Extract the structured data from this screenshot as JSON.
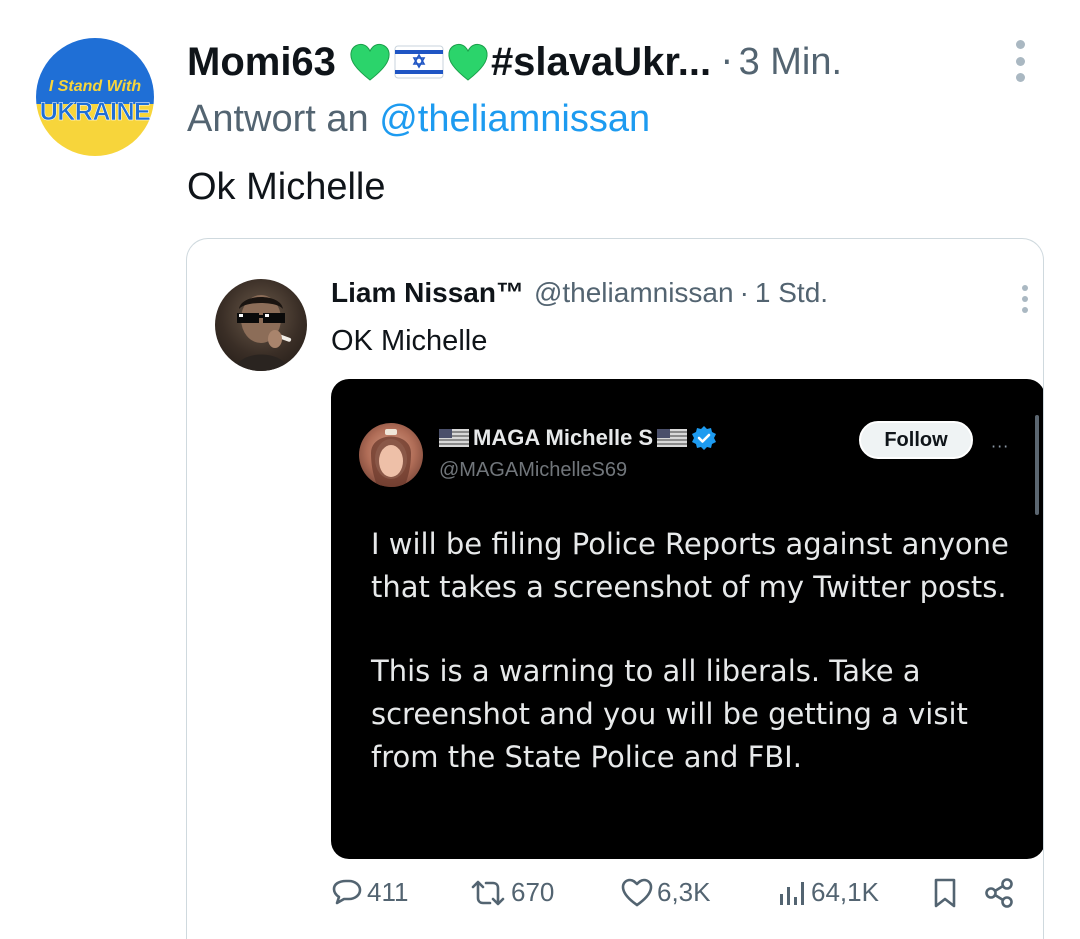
{
  "post": {
    "avatar": {
      "line1": "I Stand With",
      "line2": "UKRAINE"
    },
    "display_name_start": "Momi63",
    "display_name_end": "#slavaUkr...",
    "separator": "·",
    "time": "3 Min.",
    "reply_prefix": "Antwort an",
    "reply_handle": "@theliamnissan",
    "text": "Ok Michelle",
    "icons": [
      "green-heart-icon",
      "israel-flag-icon",
      "green-heart-icon",
      "more-vert-icon"
    ]
  },
  "quote": {
    "name": "Liam Nissan™",
    "handle": "@theliamnissan",
    "separator": "·",
    "time": "1 Std.",
    "text": "OK Michelle",
    "embedded": {
      "name": "MAGA Michelle S",
      "handle": "@MAGAMichelleS69",
      "follow_label": "Follow",
      "more_label": "···",
      "paragraph1": "I will be filing Police Reports against anyone that takes a screenshot of my Twitter posts.",
      "paragraph2": "This is a warning to all liberals. Take a screenshot and you will be getting a visit from the State Police and FBI.",
      "icons": [
        "us-flag-icon",
        "us-flag-icon",
        "verified-badge-icon"
      ]
    }
  },
  "actions": {
    "replies": "411",
    "reposts": "670",
    "likes": "6,3K",
    "views": "64,1K"
  },
  "colors": {
    "link": "#1d9bf0",
    "secondary_text": "#536471",
    "heart_green": "#2bd46b",
    "ukraine_blue": "#1f6fd6",
    "ukraine_yellow": "#f7d53b"
  }
}
